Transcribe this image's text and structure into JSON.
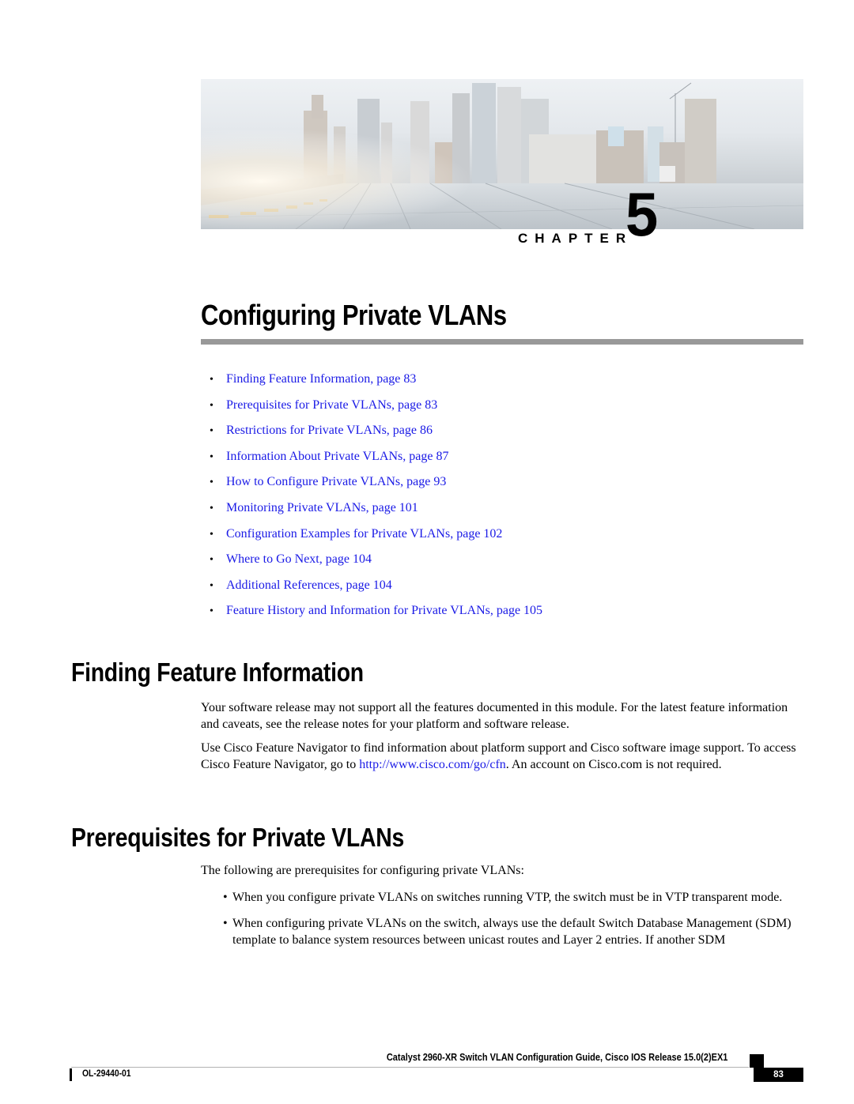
{
  "banner": {
    "image_description": "city-skyline-rooftop-solar-panels-photo",
    "chapter_label": "CHAPTER",
    "chapter_number": "5"
  },
  "title": "Configuring Private VLANs",
  "toc": [
    {
      "label": "Finding Feature Information,  page  83"
    },
    {
      "label": "Prerequisites for Private VLANs,  page  83"
    },
    {
      "label": "Restrictions for Private VLANs,  page  86"
    },
    {
      "label": "Information About Private VLANs,  page  87"
    },
    {
      "label": "How to Configure Private VLANs,  page  93"
    },
    {
      "label": "Monitoring Private VLANs,  page  101"
    },
    {
      "label": "Configuration Examples for Private VLANs,  page  102"
    },
    {
      "label": "Where to Go Next,  page  104"
    },
    {
      "label": "Additional References,  page  104"
    },
    {
      "label": "Feature History and Information for Private VLANs,  page  105"
    }
  ],
  "bullet_glyph": "•",
  "sections": {
    "finding": {
      "heading": "Finding Feature Information",
      "p1": "Your software release may not support all the features documented in this module. For the latest feature information and caveats, see the release notes for your platform and software release.",
      "p2_before": "Use Cisco Feature Navigator to find information about platform support and Cisco software image support. To access Cisco Feature Navigator, go to ",
      "p2_link": "http://www.cisco.com/go/cfn",
      "p2_after": ". An account on Cisco.com is not required."
    },
    "prereq": {
      "heading": "Prerequisites for Private VLANs",
      "intro": "The following are prerequisites for configuring private VLANs:",
      "items": [
        "When you configure private VLANs on switches running VTP, the switch must be in VTP transparent mode.",
        "When configuring private VLANs on the switch, always use the default Switch Database Management (SDM) template to balance system resources between unicast routes and Layer 2 entries. If another SDM"
      ]
    }
  },
  "footer": {
    "guide_title": "Catalyst 2960-XR Switch VLAN Configuration Guide, Cisco IOS Release 15.0(2)EX1",
    "doc_id": "OL-29440-01",
    "page_number": "83"
  },
  "colors": {
    "link": "#1a1ae6",
    "rule": "#999999",
    "text": "#000000"
  }
}
